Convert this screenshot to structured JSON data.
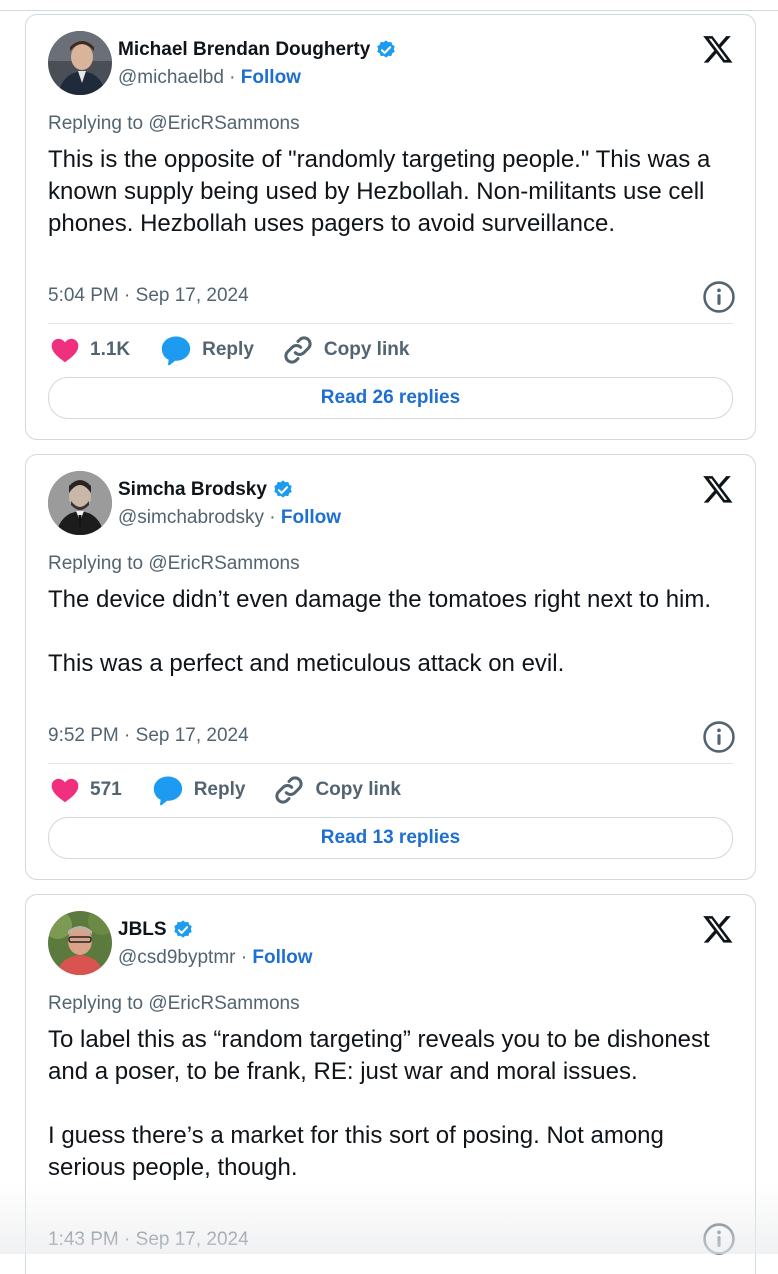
{
  "colors": {
    "accent": "#1d6fd1",
    "like": "#f0307f",
    "reply_blue": "#1d9bf0",
    "muted": "#536471",
    "text": "#0f1419",
    "border": "#cfd9de"
  },
  "tweets": [
    {
      "name": "Michael Brendan Dougherty",
      "handle": "@michaelbd",
      "dot": " · ",
      "follow": "Follow",
      "replying": "Replying to @EricRSammons",
      "text": "This is the opposite of \"randomly targeting people.\" This was a known supply being used by Hezbollah. Non-militants use cell phones. Hezbollah uses pagers to avoid surveillance.",
      "time": "5:04 PM · Sep 17, 2024",
      "likes": "1.1K",
      "reply_label": "Reply",
      "copy_label": "Copy link",
      "read_replies": "Read 26 replies",
      "icons": [
        "verified-badge-icon",
        "x-logo-icon",
        "info-icon",
        "heart-icon",
        "reply-bubble-icon",
        "link-icon"
      ]
    },
    {
      "name": "Simcha Brodsky",
      "handle": "@simchabrodsky",
      "dot": " · ",
      "follow": "Follow",
      "replying": "Replying to @EricRSammons",
      "text": "The device didn’t even damage the tomatoes right next to him.\n\nThis was a perfect and meticulous attack on evil.",
      "time": "9:52 PM · Sep 17, 2024",
      "likes": "571",
      "reply_label": "Reply",
      "copy_label": "Copy link",
      "read_replies": "Read 13 replies"
    },
    {
      "name": "JBLS",
      "handle": "@csd9byptmr",
      "dot": " · ",
      "follow": "Follow",
      "replying": "Replying to @EricRSammons",
      "text": "To label this as “random targeting” reveals you to be dishonest and a poser, to be frank, RE: just war and moral issues.\n\nI guess there’s a market for this sort of posing. Not among serious people, though.",
      "time": "1:43 PM · Sep 17, 2024"
    }
  ]
}
